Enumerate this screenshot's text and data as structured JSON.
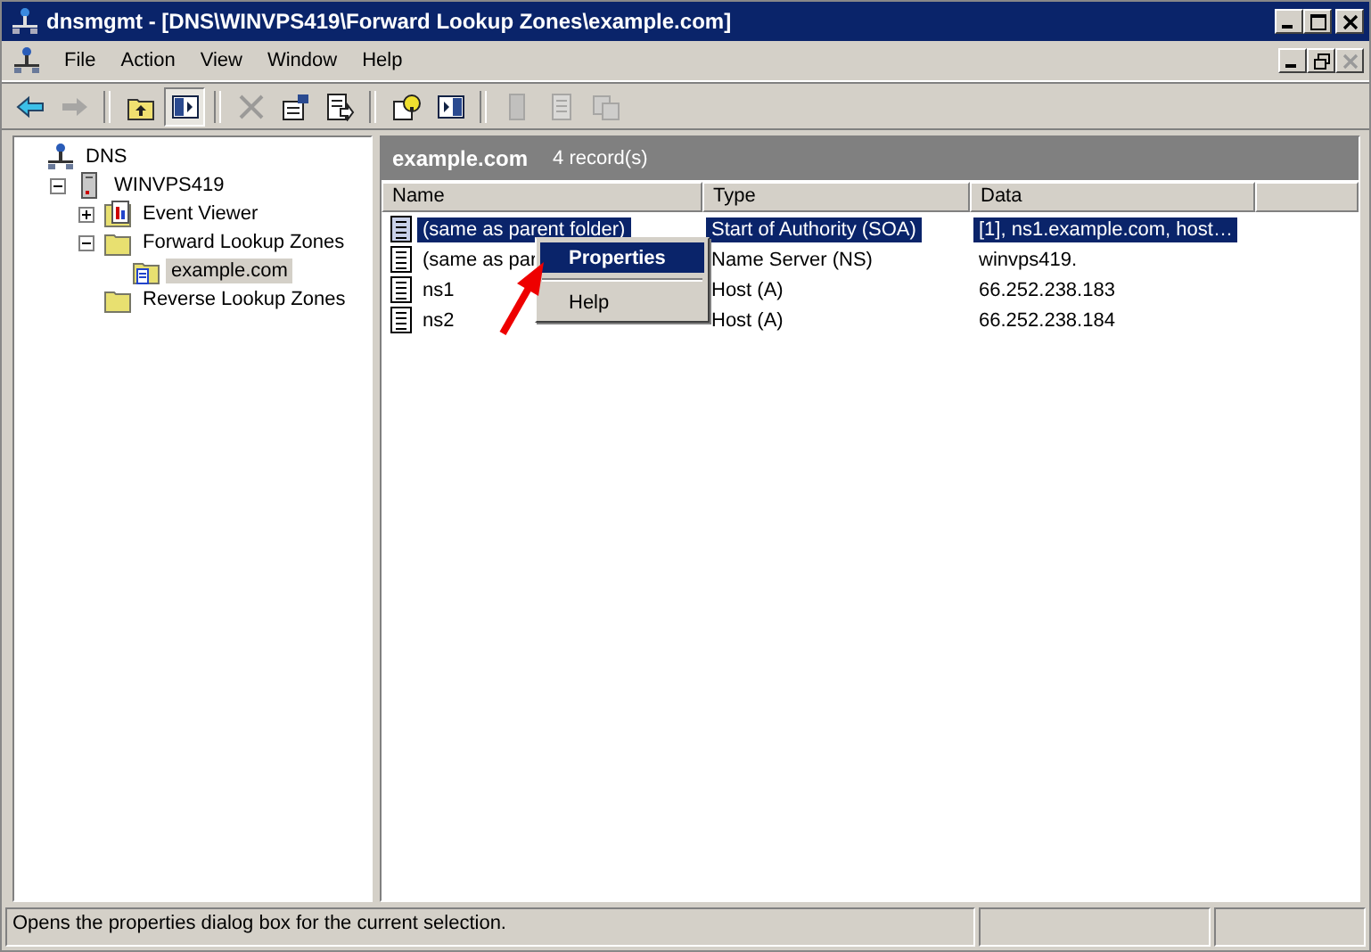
{
  "window": {
    "title": "dnsmgmt - [DNS\\WINVPS419\\Forward Lookup Zones\\example.com]"
  },
  "menu": [
    {
      "label": "File"
    },
    {
      "label": "Action"
    },
    {
      "label": "View"
    },
    {
      "label": "Window"
    },
    {
      "label": "Help"
    }
  ],
  "toolbar": [
    {
      "kind": "back",
      "disabled": false,
      "pressed": false
    },
    {
      "kind": "forward",
      "disabled": true,
      "pressed": false
    },
    {
      "kind": "sep"
    },
    {
      "kind": "up",
      "disabled": false,
      "pressed": false
    },
    {
      "kind": "tree",
      "disabled": false,
      "pressed": true
    },
    {
      "kind": "sep"
    },
    {
      "kind": "delete",
      "disabled": true,
      "pressed": false
    },
    {
      "kind": "properties",
      "disabled": false,
      "pressed": false
    },
    {
      "kind": "export",
      "disabled": false,
      "pressed": false
    },
    {
      "kind": "sep"
    },
    {
      "kind": "help",
      "disabled": false,
      "pressed": false
    },
    {
      "kind": "pane",
      "disabled": false,
      "pressed": false
    },
    {
      "kind": "sep"
    },
    {
      "kind": "server",
      "disabled": true,
      "pressed": false
    },
    {
      "kind": "record",
      "disabled": true,
      "pressed": false
    },
    {
      "kind": "copy",
      "disabled": true,
      "pressed": false
    }
  ],
  "tree": [
    {
      "label": "DNS",
      "kind": "dns",
      "selected": false,
      "children": [
        {
          "label": "WINVPS419",
          "kind": "server",
          "expanded": true,
          "selected": false,
          "children": [
            {
              "label": "Event Viewer",
              "kind": "event",
              "expanded": false,
              "selected": false
            },
            {
              "label": "Forward Lookup Zones",
              "kind": "folder",
              "expanded": true,
              "selected": false,
              "children": [
                {
                  "label": "example.com",
                  "kind": "zone",
                  "selected": true
                }
              ]
            },
            {
              "label": "Reverse Lookup Zones",
              "kind": "folder",
              "selected": false
            }
          ]
        }
      ]
    }
  ],
  "pane_header": {
    "title": "example.com",
    "count": "4 record(s)"
  },
  "table": {
    "columns": [
      "Name",
      "Type",
      "Data"
    ],
    "rows": [
      {
        "name": "(same as parent folder)",
        "type": "Start of Authority (SOA)",
        "data": "[1], ns1.example.com, host…",
        "selected": true
      },
      {
        "name": "(same as par",
        "type": "Name Server (NS)",
        "data": "winvps419.",
        "selected": false
      },
      {
        "name": "ns1",
        "type": "Host (A)",
        "data": "66.252.238.183",
        "selected": false
      },
      {
        "name": "ns2",
        "type": "Host (A)",
        "data": "66.252.238.184",
        "selected": false
      }
    ]
  },
  "context_menu": [
    {
      "label": "Properties",
      "selected": true
    },
    {
      "label": "Help",
      "selected": false
    }
  ],
  "status_bar": {
    "text": "Opens the properties dialog box for the current selection."
  }
}
